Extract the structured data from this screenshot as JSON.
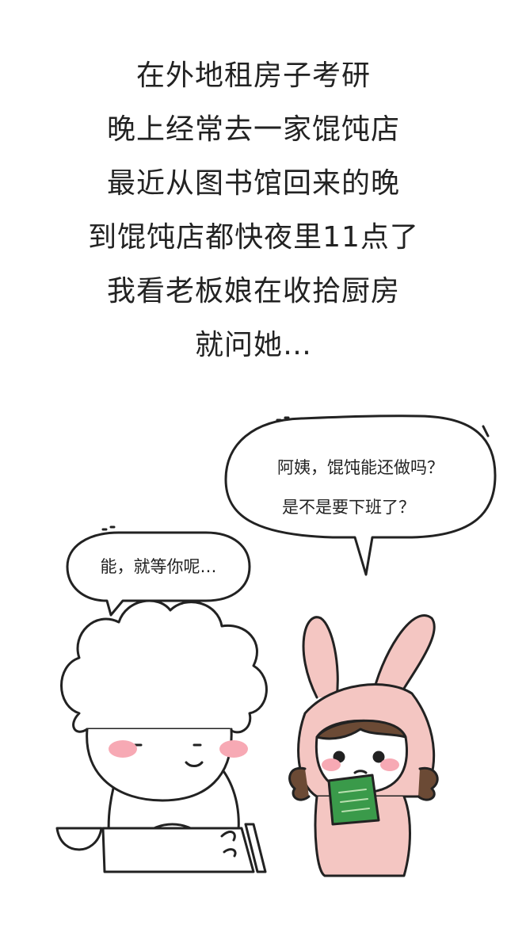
{
  "narration": {
    "lines": [
      "在外地租房子考研",
      "晚上经常去一家馄饨店",
      "最近从图书馆回来的晚",
      "到馄饨店都快夜里11点了",
      "我看老板娘在收拾厨房",
      "就问她…"
    ]
  },
  "speech": {
    "girl_line1": "阿姨，馄饨能还做吗？",
    "girl_line2": "是不是要下班了？",
    "aunt_line1": "能，就等你呢…"
  },
  "colors": {
    "ink": "#222222",
    "bunny_pink": "#f4c6c2",
    "blush": "#f7a9b4",
    "book_green": "#3a9a4a",
    "hair_brown": "#6b4a35"
  }
}
